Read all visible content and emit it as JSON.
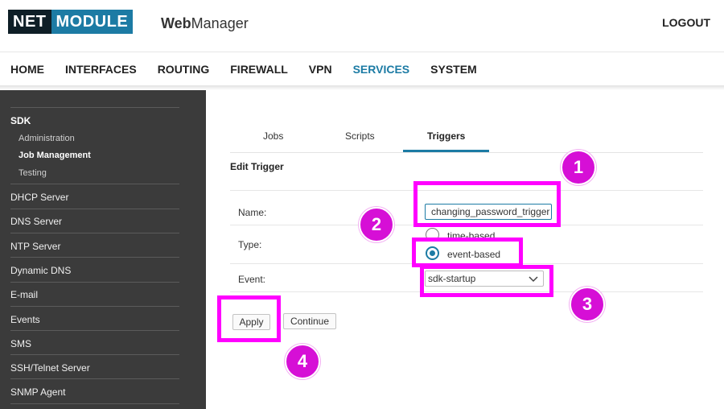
{
  "header": {
    "logo_net": "NET",
    "logo_module": "MODULE",
    "app_title_bold": "Web",
    "app_title_rest": "Manager",
    "logout": "LOGOUT"
  },
  "mainnav": [
    "HOME",
    "INTERFACES",
    "ROUTING",
    "FIREWALL",
    "VPN",
    "SERVICES",
    "SYSTEM"
  ],
  "mainnav_active": "SERVICES",
  "sidebar": {
    "section": "SDK",
    "subitems": [
      "Administration",
      "Job Management",
      "Testing"
    ],
    "active_subitem": "Job Management",
    "items": [
      "DHCP Server",
      "DNS Server",
      "NTP Server",
      "Dynamic DNS",
      "E-mail",
      "Events",
      "SMS",
      "SSH/Telnet Server",
      "SNMP Agent"
    ]
  },
  "tabs": [
    "Jobs",
    "Scripts",
    "Triggers"
  ],
  "active_tab": "Triggers",
  "form": {
    "title": "Edit Trigger",
    "name_label": "Name:",
    "name_value": "changing_password_trigger",
    "type_label": "Type:",
    "type_options": [
      "time-based",
      "event-based"
    ],
    "type_selected": "event-based",
    "event_label": "Event:",
    "event_value": "sdk-startup",
    "apply": "Apply",
    "continue": "Continue"
  },
  "annotations": [
    "1",
    "2",
    "3",
    "4"
  ],
  "colors": {
    "brand_dark": "#0e1e26",
    "brand_blue": "#1c7ba4",
    "sidebar_bg": "#3b3b3b",
    "annotation": "#ff00ff"
  }
}
